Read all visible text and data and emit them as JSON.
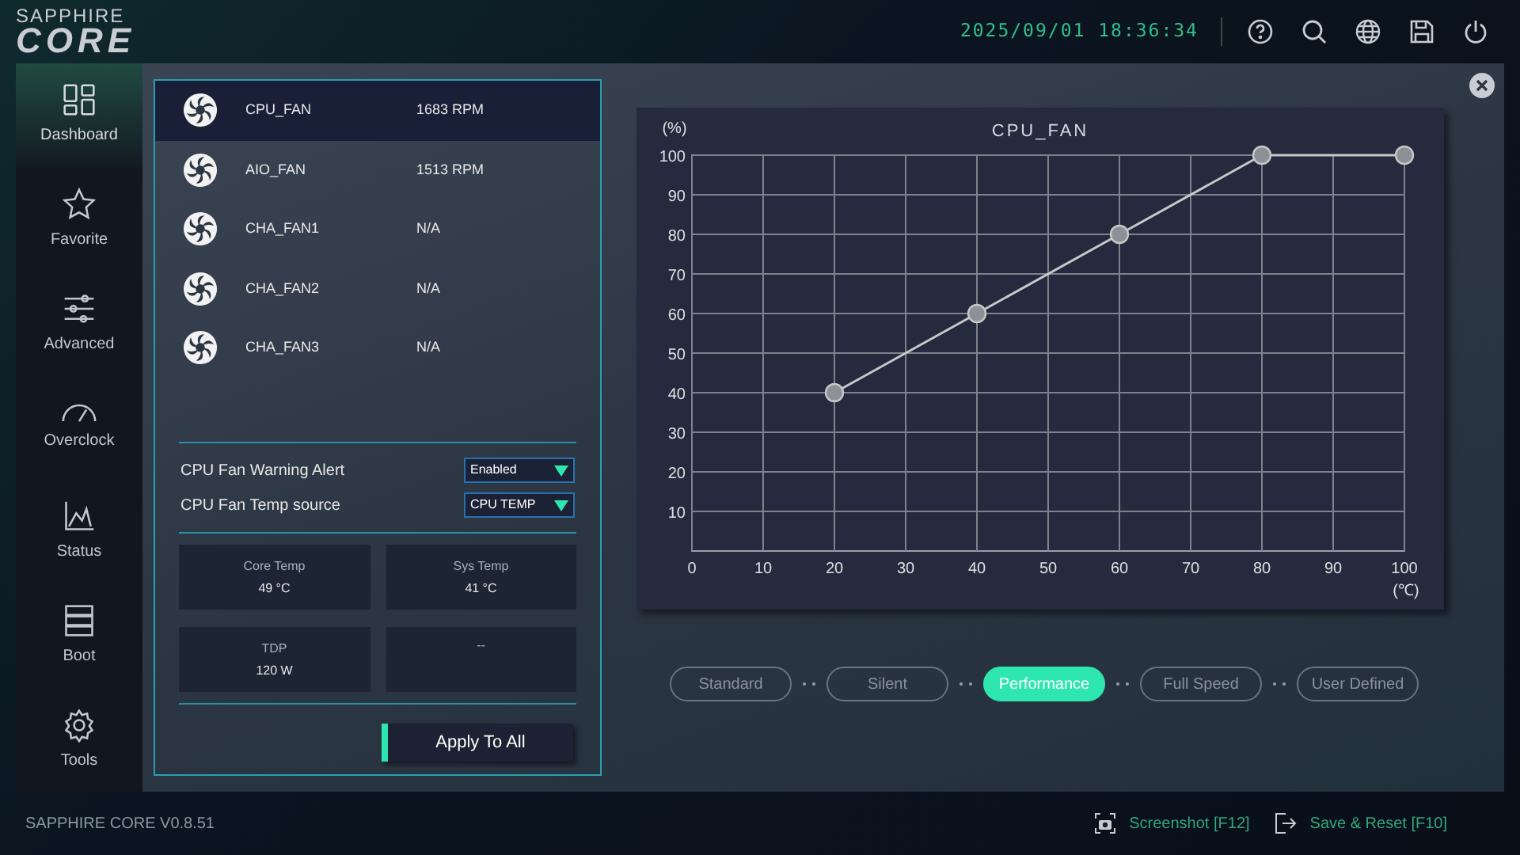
{
  "header": {
    "logo_top": "SAPPHIRE",
    "logo_main": "CORE",
    "datetime": "2025/09/01 18:36:34"
  },
  "sidebar": {
    "items": [
      {
        "label": "Dashboard",
        "kind": "dashboard",
        "selected": true
      },
      {
        "label": "Favorite",
        "kind": "favorite",
        "selected": false
      },
      {
        "label": "Advanced",
        "kind": "advanced",
        "selected": false
      },
      {
        "label": "Overclock",
        "kind": "overclock",
        "selected": false
      },
      {
        "label": "Status",
        "kind": "status",
        "selected": false
      },
      {
        "label": "Boot",
        "kind": "boot",
        "selected": false
      },
      {
        "label": "Tools",
        "kind": "tools",
        "selected": false
      }
    ]
  },
  "fans": [
    {
      "name": "CPU_FAN",
      "speed": "1683 RPM",
      "selected": true
    },
    {
      "name": "AIO_FAN",
      "speed": "1513 RPM",
      "selected": false
    },
    {
      "name": "CHA_FAN1",
      "speed": "N/A",
      "selected": false
    },
    {
      "name": "CHA_FAN2",
      "speed": "N/A",
      "selected": false
    },
    {
      "name": "CHA_FAN3",
      "speed": "N/A",
      "selected": false
    }
  ],
  "settings": [
    {
      "label": "CPU Fan Warning Alert",
      "value": "Enabled"
    },
    {
      "label": "CPU Fan Temp source",
      "value": "CPU TEMP"
    }
  ],
  "stats": [
    {
      "label": "Core Temp",
      "value": "49 °C"
    },
    {
      "label": "Sys Temp",
      "value": "41 °C"
    },
    {
      "label": "TDP",
      "value": "120 W"
    },
    {
      "label": "--"
    }
  ],
  "apply_button": "Apply To All",
  "chart": {
    "chart_data": {
      "type": "line",
      "title": "CPU_FAN",
      "xlabel": "(℃)",
      "ylabel": "(%)",
      "x": [
        20,
        40,
        60,
        80,
        100
      ],
      "grid": true,
      "series": [
        {
          "color": "#c8c8c8",
          "marker": "circle",
          "values": [
            40,
            60,
            80,
            100,
            100
          ]
        }
      ],
      "xlim": [
        0,
        100
      ],
      "ylim": [
        0,
        100
      ],
      "xticks": [
        0,
        10,
        20,
        30,
        40,
        50,
        60,
        70,
        80,
        90,
        100
      ],
      "yticks": [
        10,
        20,
        30,
        40,
        50,
        60,
        70,
        80,
        90,
        100
      ]
    }
  },
  "modes": [
    {
      "label": "Standard",
      "selected": false
    },
    {
      "label": "Silent",
      "selected": false
    },
    {
      "label": "Performance",
      "selected": true
    },
    {
      "label": "Full Speed",
      "selected": false
    },
    {
      "label": "User Defined",
      "selected": false
    }
  ],
  "footer": {
    "version": "SAPPHIRE CORE V0.8.51",
    "actions": [
      {
        "label": "Screenshot [F12]",
        "kind": "screenshot"
      },
      {
        "label": "Save & Reset [F10]",
        "kind": "save_reset"
      }
    ]
  }
}
